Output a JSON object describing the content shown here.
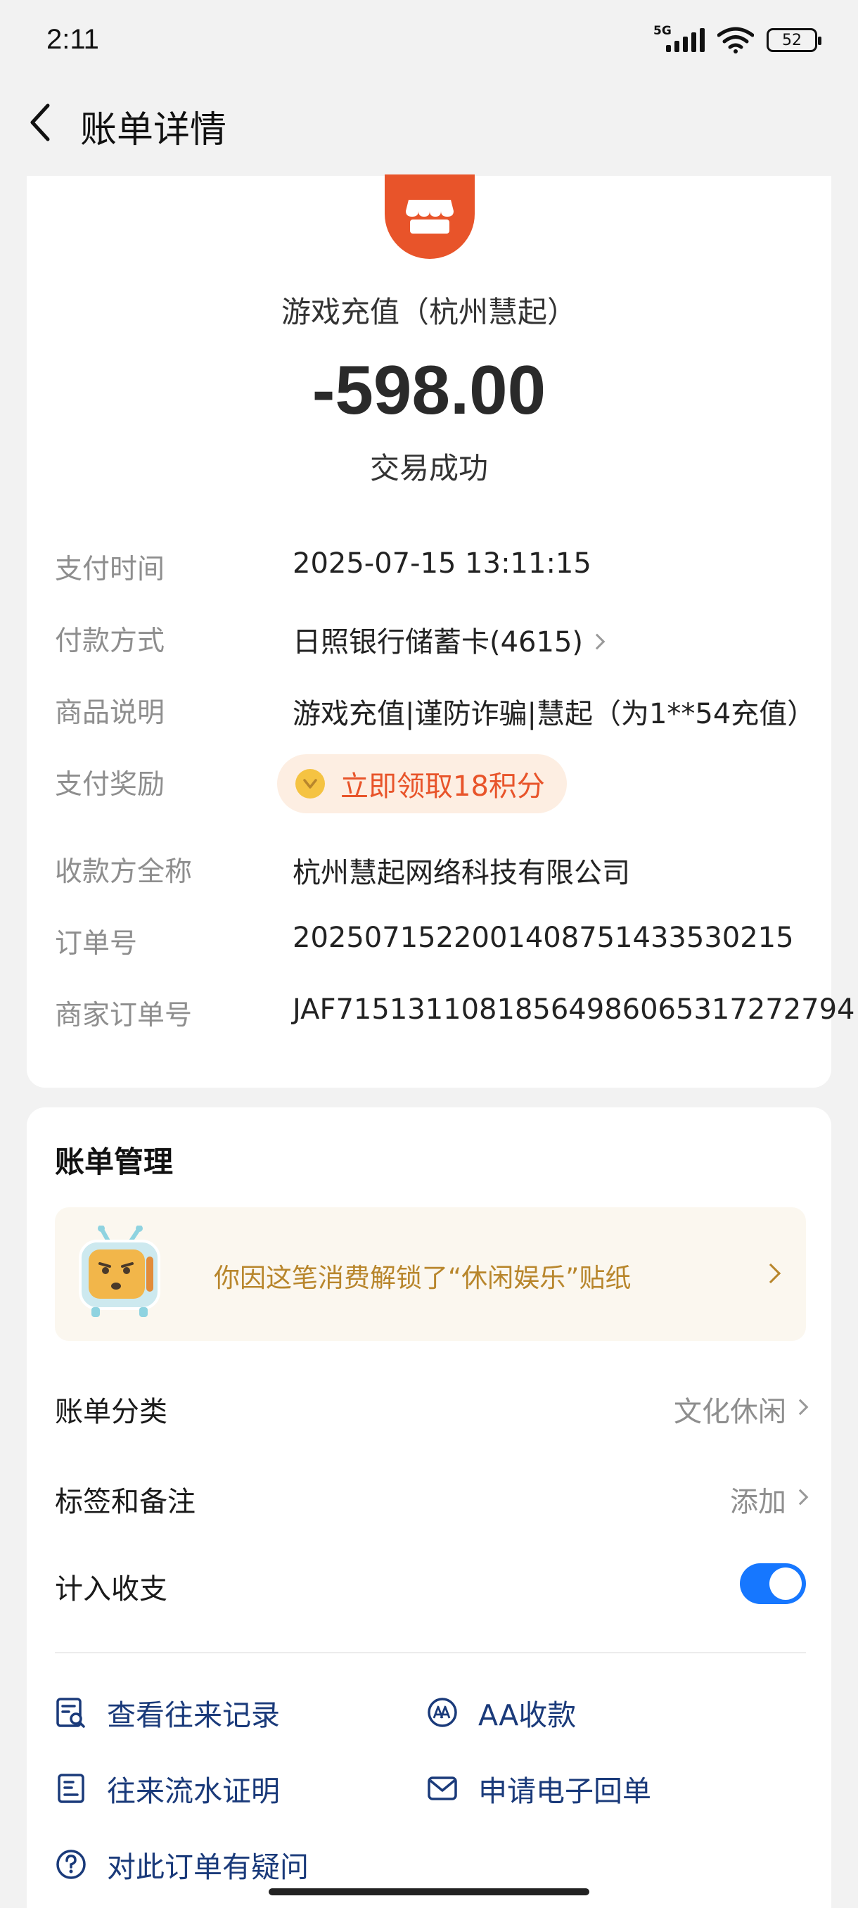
{
  "status_bar": {
    "time": "2:11",
    "network": "5G",
    "battery": "52"
  },
  "header": {
    "title": "账单详情"
  },
  "transaction": {
    "merchant_name": "游戏充值（杭州慧起）",
    "amount": "-598.00",
    "status": "交易成功",
    "details": [
      {
        "label": "支付时间",
        "value": "2025-07-15 13:11:15"
      },
      {
        "label": "付款方式",
        "value": "日照银行储蓄卡(4615)"
      },
      {
        "label": "商品说明",
        "value": "游戏充值|谨防诈骗|慧起（为1**54充值）"
      },
      {
        "label": "支付奖励",
        "value": "立即领取18积分"
      },
      {
        "label": "收款方全称",
        "value": "杭州慧起网络科技有限公司"
      },
      {
        "label": "订单号",
        "value": "2025071522001408751433530215"
      },
      {
        "label": "商家订单号",
        "value": "JAF71513110818564986065317272794"
      }
    ]
  },
  "management": {
    "title": "账单管理",
    "sticker_text": "你因这笔消费解锁了“休闲娱乐”贴纸",
    "category_label": "账单分类",
    "category_value": "文化休闲",
    "tags_label": "标签和备注",
    "tags_value": "添加",
    "include_label": "计入收支",
    "include_enabled": true,
    "actions": [
      {
        "label": "查看往来记录",
        "icon": "record-search-icon"
      },
      {
        "label": "AA收款",
        "icon": "aa-icon"
      },
      {
        "label": "往来流水证明",
        "icon": "statement-icon"
      },
      {
        "label": "申请电子回单",
        "icon": "mail-icon"
      },
      {
        "label": "对此订单有疑问",
        "icon": "question-icon"
      }
    ]
  },
  "colors": {
    "brand_orange": "#e8542a",
    "toggle_blue": "#1677ff",
    "action_text": "#1a3a7a"
  }
}
